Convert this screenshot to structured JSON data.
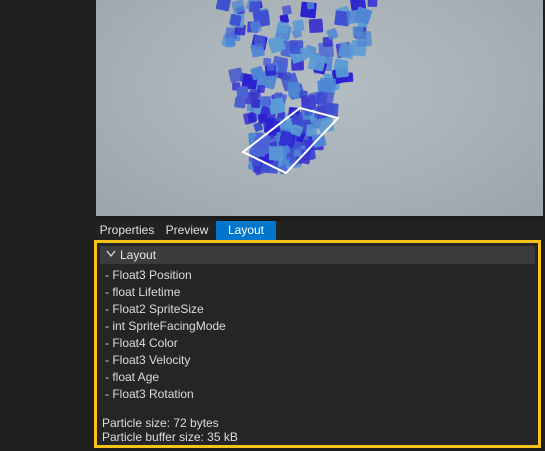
{
  "tabs": [
    {
      "label": "Properties",
      "active": false
    },
    {
      "label": "Preview",
      "active": false
    },
    {
      "label": "Layout",
      "active": true
    }
  ],
  "layout": {
    "header": "Layout",
    "fields": [
      "- Float3 Position",
      "- float Lifetime",
      "- Float2 SpriteSize",
      "- int SpriteFacingMode",
      "- Float4 Color",
      "- Float3 Velocity",
      "- float Age",
      "- Float3 Rotation"
    ],
    "particle_size": "Particle size: 72 bytes",
    "buffer_size": "Particle buffer size: 35 kB"
  },
  "colors": {
    "accent_tab": "#0077cc",
    "highlight_border": "#f7c21c",
    "particle_palette": [
      "#2a1fd1",
      "#3a36cf",
      "#4a63d6",
      "#4f86d4",
      "#5b9bd5",
      "#3d4fd0"
    ]
  },
  "icons": {
    "collapse": "chevron-down-icon"
  }
}
